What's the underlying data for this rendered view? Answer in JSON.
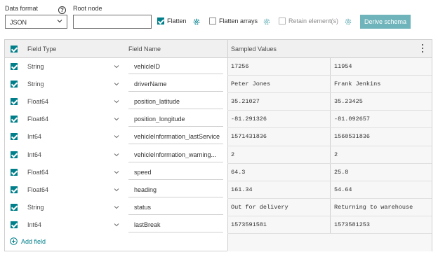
{
  "toolbar": {
    "data_format_label": "Data format",
    "data_format_value": "JSON",
    "help_glyph": "?",
    "root_node_label": "Root node",
    "root_node_value": "",
    "flatten": {
      "label": "Flatten",
      "checked": true
    },
    "flatten_arrays": {
      "label": "Flatten arrays",
      "checked": false
    },
    "retain_elements": {
      "label": "Retain element(s)",
      "checked": false,
      "disabled": true
    },
    "derive_button": "Derive schema"
  },
  "grid": {
    "headers": {
      "field_type": "Field Type",
      "field_name": "Field Name",
      "sampled_values": "Sampled Values"
    },
    "rows": [
      {
        "checked": true,
        "type": "String",
        "name": "vehicleID",
        "s1": "17256",
        "s2": "11954"
      },
      {
        "checked": true,
        "type": "String",
        "name": "driverName",
        "s1": "Peter Jones",
        "s2": "Frank Jenkins"
      },
      {
        "checked": true,
        "type": "Float64",
        "name": "position_latitude",
        "s1": "35.21027",
        "s2": "35.23425"
      },
      {
        "checked": true,
        "type": "Float64",
        "name": "position_longitude",
        "s1": "-81.291326",
        "s2": "-81.092657"
      },
      {
        "checked": true,
        "type": "Int64",
        "name": "vehicleInformation_lastService",
        "s1": "1571431836",
        "s2": "1560531836"
      },
      {
        "checked": true,
        "type": "Int64",
        "name": "vehicleInformation_warning...",
        "s1": "2",
        "s2": "2"
      },
      {
        "checked": true,
        "type": "Float64",
        "name": "speed",
        "s1": "64.3",
        "s2": "25.8"
      },
      {
        "checked": true,
        "type": "Float64",
        "name": "heading",
        "s1": "161.34",
        "s2": "54.64"
      },
      {
        "checked": true,
        "type": "String",
        "name": "status",
        "s1": "Out for delivery",
        "s2": "Returning to warehouse"
      },
      {
        "checked": true,
        "type": "Int64",
        "name": "lastBreak",
        "s1": "1573591581",
        "s2": "1573581253"
      }
    ],
    "add_field": "Add field"
  },
  "colors": {
    "accent": "#007f8a",
    "derive_button": "#6fb4bb",
    "header_bg": "#f0f0f0",
    "sample_bg": "#f7f7f7"
  },
  "icons": {
    "help": "help-circle-icon",
    "gear": "gear-icon",
    "chevron": "chevron-down-icon",
    "kebab": "more-vertical-icon",
    "plus": "plus-circle-icon"
  }
}
